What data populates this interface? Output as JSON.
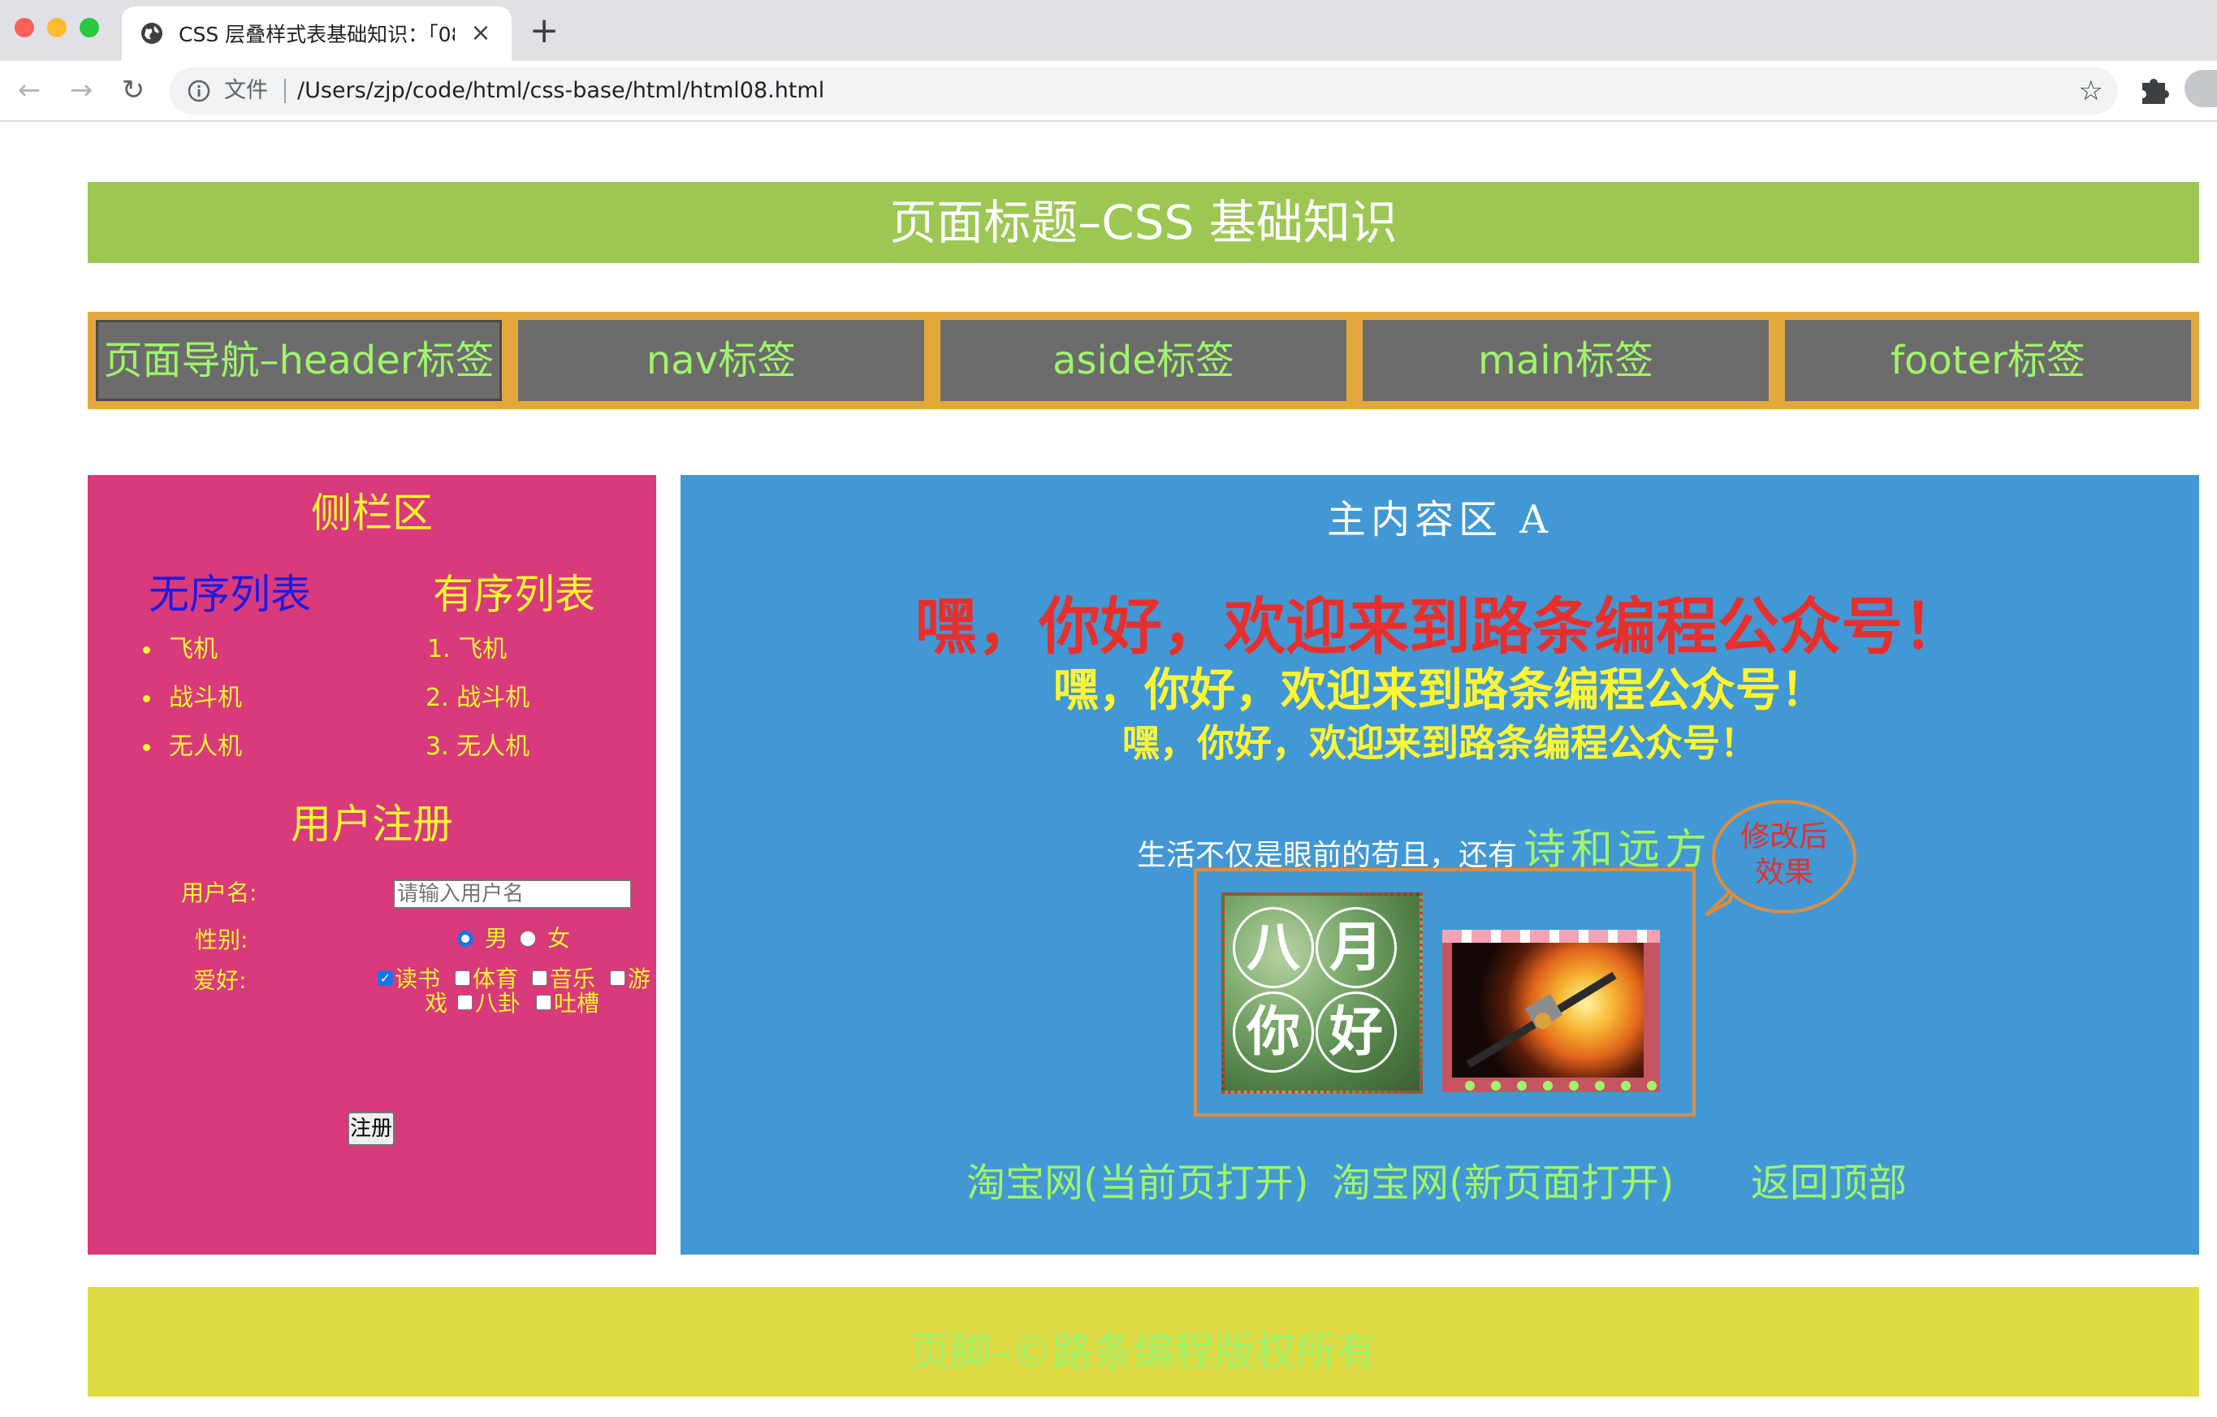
{
  "browser": {
    "tab_title": "CSS 层叠样式表基础知识：「08",
    "tab_close": "×",
    "new_tab": "+",
    "back": "←",
    "forward": "→",
    "reload": "↻",
    "scheme_label": "文件",
    "url": "/Users/zjp/code/html/css-base/html/html08.html",
    "bookmark_star": "☆"
  },
  "header": {
    "title": "页面标题–CSS 基础知识"
  },
  "nav": {
    "items": [
      {
        "label": "页面导航–header标签"
      },
      {
        "label": "nav标签"
      },
      {
        "label": "aside标签"
      },
      {
        "label": "main标签"
      },
      {
        "label": "footer标签"
      }
    ]
  },
  "aside": {
    "title": "侧栏区",
    "ul_heading": "无序列表",
    "ol_heading": "有序列表",
    "ul_items": [
      "飞机",
      "战斗机",
      "无人机"
    ],
    "ol_items": [
      "1. 飞机",
      "2. 战斗机",
      "3. 无人机"
    ],
    "register_title": "用户注册",
    "form": {
      "username_label": "用户名:",
      "username_placeholder": "请输入用户名",
      "gender_label": "性别:",
      "gender_options": [
        "男",
        "女"
      ],
      "gender_selected": "男",
      "hobby_label": "爱好:",
      "hobbies": [
        "读书",
        "体育",
        "音乐",
        "游",
        "戏",
        "八卦",
        "吐槽"
      ],
      "hobbies_checked": [
        "读书"
      ],
      "submit_label": "注册"
    }
  },
  "main": {
    "title": "主内容区 A",
    "greeting_h1": "嘿，你好，欢迎来到路条编程公众号！",
    "greeting_h2": "嘿，你好，欢迎来到路条编程公众号！",
    "greeting_h3": "嘿，你好，欢迎来到路条编程公众号！",
    "quote_plain": "生活不仅是眼前的苟且，还有",
    "quote_fancy": "诗和远方",
    "bubble_line1": "修改后",
    "bubble_line2": "效果",
    "image1_glyphs": [
      "八",
      "月",
      "你",
      "好"
    ],
    "links": [
      "淘宝网(当前页打开)",
      "淘宝网(新页面打开)",
      "返回顶部"
    ]
  },
  "footer": {
    "text": "页脚–©路条编程版权所有"
  },
  "colors": {
    "header_bg": "#9dc753",
    "nav_bg": "#e3a83c",
    "nav_item_bg": "#6c6c6c",
    "aside_bg": "#d83a7c",
    "main_bg": "#4298d5",
    "footer_bg": "#dfdb45",
    "accent_green": "#9ff46a",
    "accent_yellow": "#fff533",
    "accent_red": "#e6302e"
  }
}
